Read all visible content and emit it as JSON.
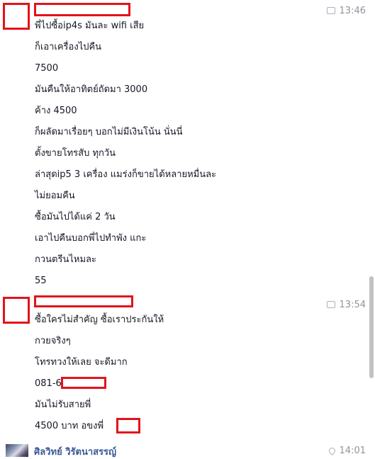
{
  "conversation": {
    "groups": [
      {
        "timestamp": "13:46",
        "messages": [
          "พี่ไปซื้อip4s มันละ wifi เสีย",
          "ก็เอาเครื่องไปคืน",
          "7500",
          "มันคืนให้อาทิตย์ถัดมา 3000",
          "ค้าง 4500",
          "ก็ผลัดมาเรื่อยๆ บอกไม่มีเงินโน้น นั่นนี่",
          "ตั้งขายโทรสับ ทุกวัน",
          "ล่าสุดip5 3 เครื่อง แมร่งก็ขายได้หลายหมื่นละ",
          "ไม่ยอมคืน",
          "ซื้อมันไปได้แค่ 2 วัน",
          "เอาไปคืนบอกพี่ไปทำพัง แกะ",
          "กวนตรีนไหมละ",
          "55"
        ]
      },
      {
        "timestamp": "13:54",
        "messages": [
          "ซื้อใครไม่สำคัญ ซื้อเราประกันให้",
          "กวยจริงๆ",
          "โทรทวงให้เลย จะดีมาก",
          "081-6",
          "มันไม่รับสายพี่",
          "4500 บาท อขงพี่"
        ]
      },
      {
        "sender": "ศิลวิทย์ วิรัตนาสรรญ์",
        "timestamp": "14:01"
      }
    ]
  },
  "colors": {
    "redaction": "#e3131b",
    "sender_name": "#3b5998",
    "timestamp": "#90949c"
  }
}
